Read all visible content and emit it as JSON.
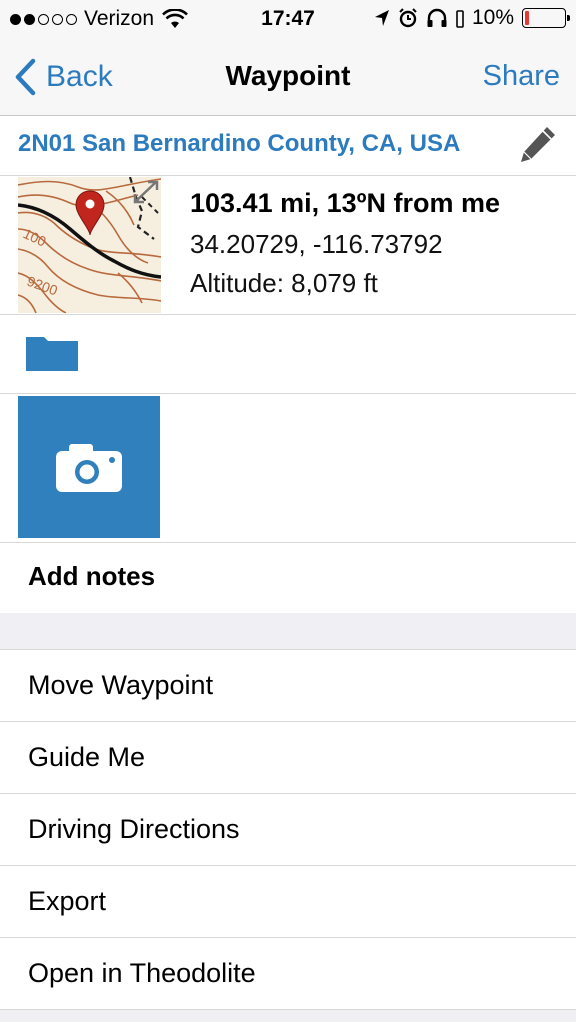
{
  "status_bar": {
    "carrier": "Verizon",
    "time": "17:47",
    "battery": "10%",
    "battery_level": 0.1
  },
  "nav": {
    "back_label": "Back",
    "title": "Waypoint",
    "share_label": "Share"
  },
  "waypoint": {
    "location": "2N01 San Bernardino County, CA, USA",
    "distance": "103.41 mi, 13ºN from me",
    "coordinates": "34.20729, -116.73792",
    "altitude": "Altitude: 8,079 ft"
  },
  "map_labels": {
    "label_top": "100",
    "label_bottom": "9200"
  },
  "notes": {
    "label": "Add notes"
  },
  "actions": [
    {
      "label": "Move Waypoint"
    },
    {
      "label": "Guide Me"
    },
    {
      "label": "Driving Directions"
    },
    {
      "label": "Export"
    },
    {
      "label": "Open in Theodolite"
    }
  ],
  "colors": {
    "accent": "#2c7bbf",
    "camera_tile": "#2f80bd",
    "pin": "#c0261d"
  }
}
